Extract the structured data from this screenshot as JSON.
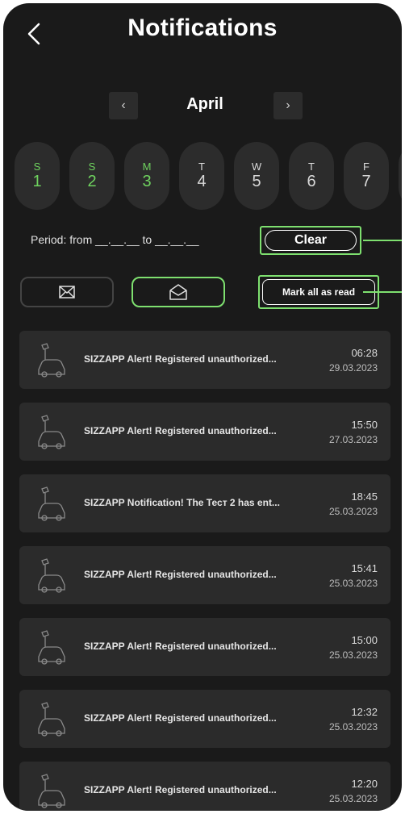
{
  "header": {
    "title": "Notifications",
    "back_icon": "chevron-left-icon"
  },
  "calendar": {
    "month": "April",
    "prev_label": "‹",
    "next_label": "›",
    "days": [
      {
        "letter": "S",
        "num": "1",
        "active": true
      },
      {
        "letter": "S",
        "num": "2",
        "active": true
      },
      {
        "letter": "M",
        "num": "3",
        "active": true
      },
      {
        "letter": "T",
        "num": "4",
        "active": false
      },
      {
        "letter": "W",
        "num": "5",
        "active": false
      },
      {
        "letter": "T",
        "num": "6",
        "active": false
      },
      {
        "letter": "F",
        "num": "7",
        "active": false
      }
    ]
  },
  "period": {
    "text": "Period: from __.__.__ to __.__.__",
    "clear_label": "Clear"
  },
  "filters": {
    "unread_icon": "envelope-closed-icon",
    "read_icon": "envelope-open-icon",
    "mark_all_label": "Mark all as read"
  },
  "notifications": [
    {
      "text": "SIZZAPP Alert! Registered unauthorized...",
      "time": "06:28",
      "date": "29.03.2023"
    },
    {
      "text": "SIZZAPP Alert! Registered unauthorized...",
      "time": "15:50",
      "date": "27.03.2023"
    },
    {
      "text": "SIZZAPP Notification! The Тест 2 has ent...",
      "time": "18:45",
      "date": "25.03.2023"
    },
    {
      "text": "SIZZAPP Alert! Registered unauthorized...",
      "time": "15:41",
      "date": "25.03.2023"
    },
    {
      "text": "SIZZAPP Alert! Registered unauthorized...",
      "time": "15:00",
      "date": "25.03.2023"
    },
    {
      "text": "SIZZAPP Alert! Registered unauthorized...",
      "time": "12:32",
      "date": "25.03.2023"
    },
    {
      "text": "SIZZAPP Alert! Registered unauthorized...",
      "time": "12:20",
      "date": "25.03.2023"
    }
  ],
  "colors": {
    "accent": "#7ee06f",
    "active_day": "#6fd35f",
    "background": "#1a1a1a",
    "card": "#2b2b2b"
  }
}
